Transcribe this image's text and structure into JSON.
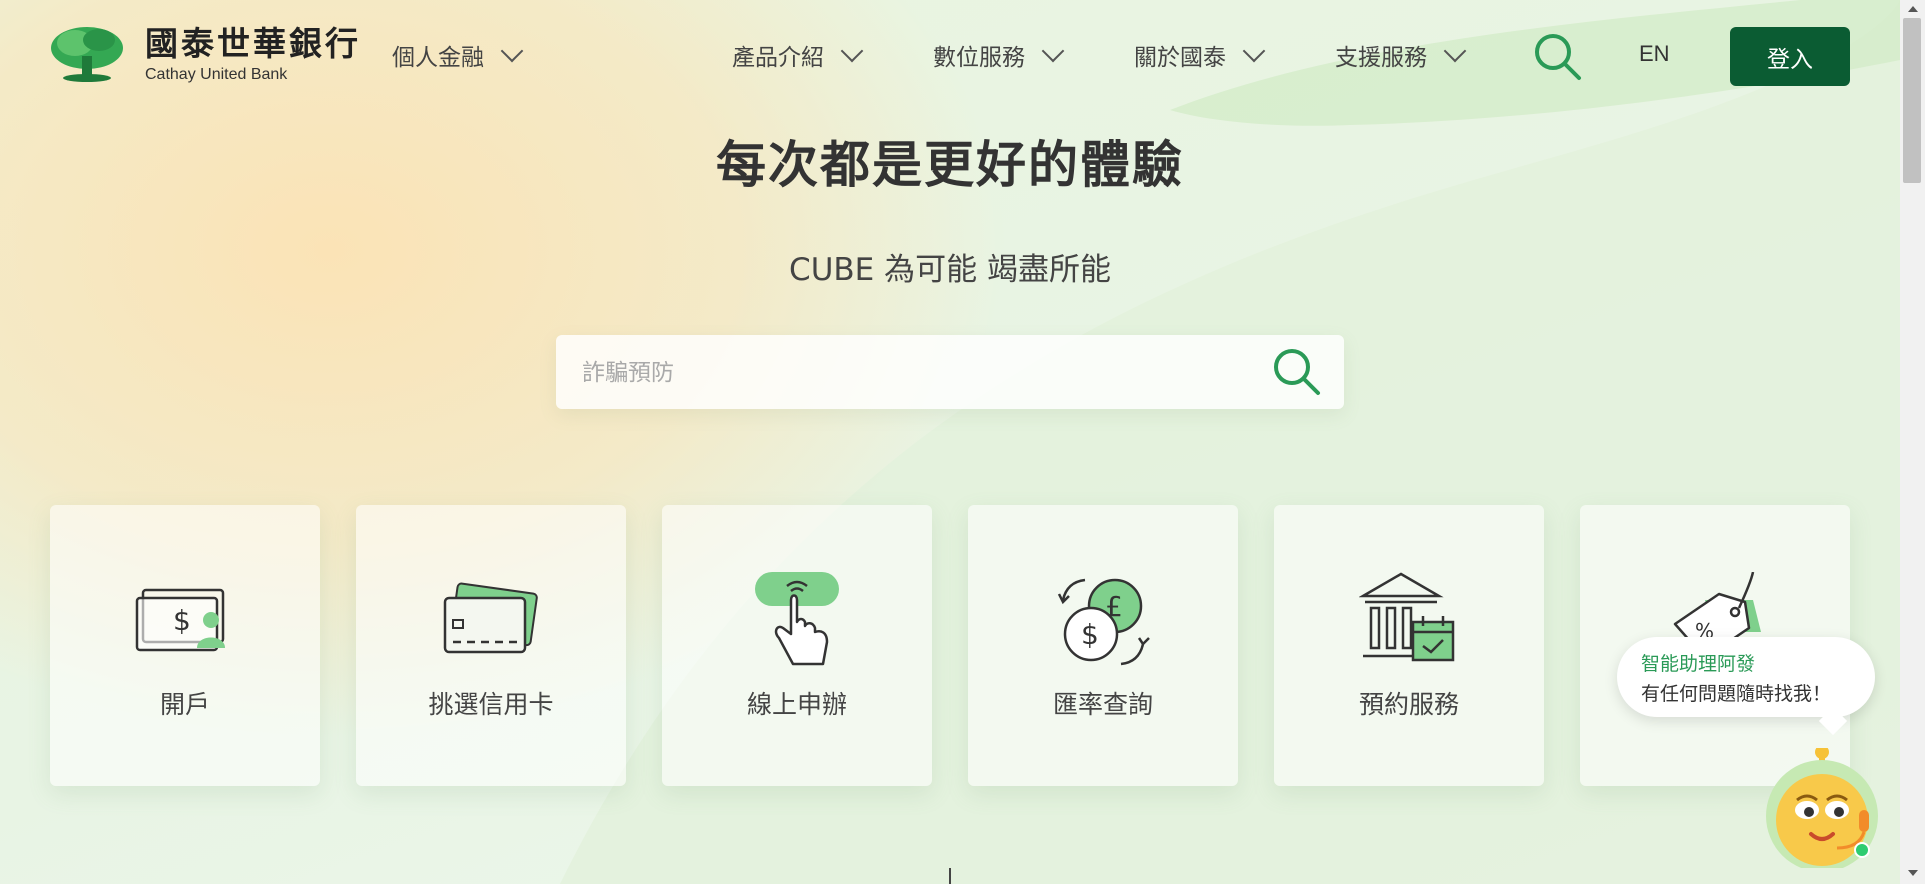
{
  "brand": {
    "name_cn": "國泰世華銀行",
    "name_en": "Cathay United Bank"
  },
  "header": {
    "personal_menu": "個人金融",
    "nav": [
      {
        "label": "產品介紹"
      },
      {
        "label": "數位服務"
      },
      {
        "label": "關於國泰"
      },
      {
        "label": "支援服務"
      }
    ],
    "lang": "EN",
    "login_label": "登入"
  },
  "hero": {
    "title": "每次都是更好的體驗",
    "subtitle": "CUBE 為可能 竭盡所能",
    "search_placeholder": "詐騙預防"
  },
  "quick_links": [
    {
      "label": "開戶",
      "icon": "open-account-icon"
    },
    {
      "label": "挑選信用卡",
      "icon": "credit-card-icon"
    },
    {
      "label": "線上申辦",
      "icon": "online-apply-icon"
    },
    {
      "label": "匯率查詢",
      "icon": "exchange-rate-icon"
    },
    {
      "label": "預約服務",
      "icon": "appointment-icon"
    },
    {
      "label": "",
      "icon": "promotion-tag-icon"
    }
  ],
  "assistant": {
    "title": "智能助理阿發",
    "message": "有任何問題隨時找我！"
  },
  "colors": {
    "brand_green": "#0b5c33",
    "accent_green": "#2a9a57",
    "light_green": "#7fd08c"
  }
}
